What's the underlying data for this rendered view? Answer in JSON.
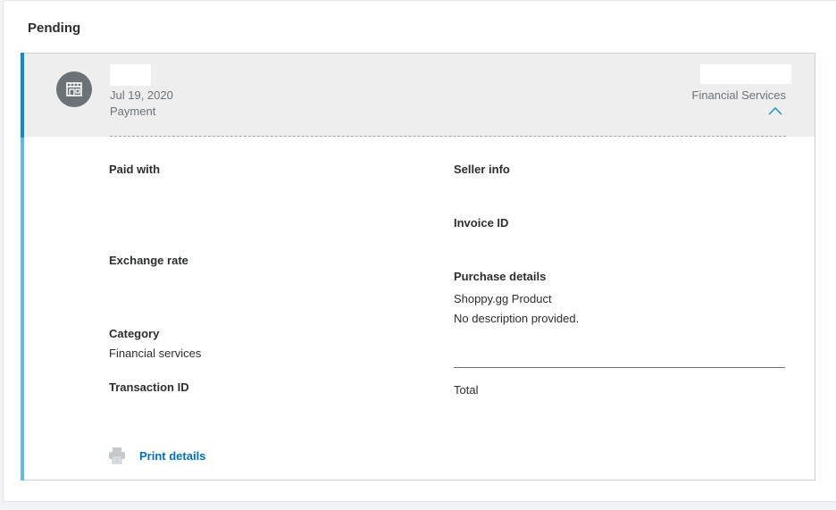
{
  "section": {
    "heading": "Pending"
  },
  "transaction": {
    "date": "Jul 19, 2020",
    "type": "Payment",
    "category_label": "Financial Services",
    "icon": "store-icon",
    "expand_icon": "chevron-up-icon"
  },
  "details": {
    "paid_with_label": "Paid with",
    "exchange_rate_label": "Exchange rate",
    "category_label": "Category",
    "category_value": "Financial services",
    "transaction_id_label": "Transaction ID",
    "seller_info_label": "Seller info",
    "invoice_id_label": "Invoice ID",
    "purchase_details_label": "Purchase details",
    "product_name": "Shoppy.gg Product",
    "product_description": "No description provided.",
    "total_label": "Total"
  },
  "actions": {
    "print_label": "Print details",
    "print_icon": "printer-icon"
  },
  "colors": {
    "accent": "#0d8bd0",
    "accent_light": "#5bbdea",
    "link": "#0070ba",
    "muted_text": "#6c7378"
  }
}
